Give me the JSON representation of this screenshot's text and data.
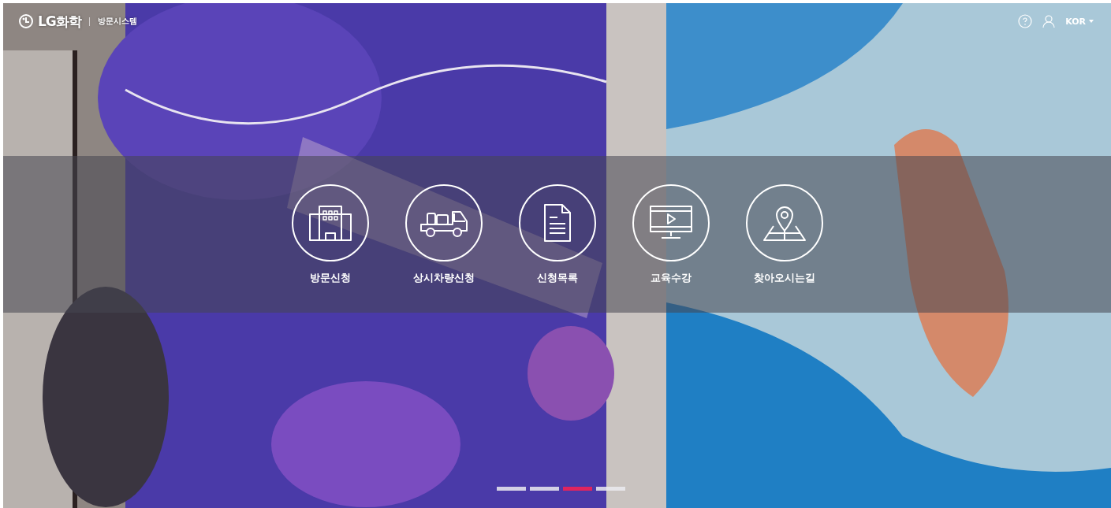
{
  "header": {
    "logo": "LG화학",
    "system_name": "방문시스템",
    "language": "KOR"
  },
  "menu": [
    {
      "kind": "building",
      "label": "방문신청"
    },
    {
      "kind": "truck",
      "label": "상시차량신청"
    },
    {
      "kind": "document",
      "label": "신청목록"
    },
    {
      "kind": "video",
      "label": "교육수강"
    },
    {
      "kind": "map",
      "label": "찾아오시는길"
    }
  ],
  "slides": [
    {
      "selected": false
    },
    {
      "selected": false
    },
    {
      "selected": true
    },
    {
      "selected": false
    }
  ]
}
